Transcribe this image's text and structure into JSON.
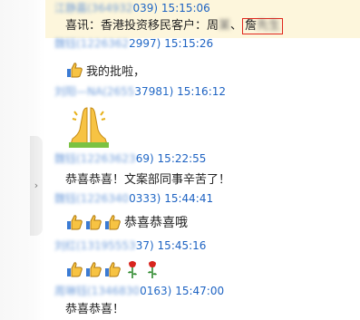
{
  "ui": {
    "collapse_glyph": "›",
    "icons": {
      "thumb": "thumbs-up-emoji",
      "rose": "rose-emoji",
      "praying": "praying-hands-emoji"
    }
  },
  "messages": [
    {
      "sender_blur": "江静嘉(364932",
      "sender_tail": "039)",
      "time": "15:15:06",
      "text_prefix": "喜讯：香港投资移民客户：周",
      "text_blur_1": "某",
      "text_sep": "、",
      "text_boxed_char": "詹",
      "text_blur_2": "先生"
    },
    {
      "sender_blur": "魏钰(1226362",
      "sender_tail": "2997)",
      "time": "15:15:26",
      "text": "我的批啦，"
    },
    {
      "sender_blur": "刘阳—NA(2655",
      "sender_tail": "37981)",
      "time": "15:16:12"
    },
    {
      "sender_blur": "魏钰(12263623",
      "sender_tail": "69)",
      "time": "15:22:55",
      "text": "恭喜恭喜！文案部同事辛苦了！"
    },
    {
      "sender_blur": "魏钰(1226340",
      "sender_tail": "0333)",
      "time": "15:44:41",
      "text": "恭喜恭喜哦"
    },
    {
      "sender_blur": "刘红(13195553",
      "sender_tail": "37)",
      "time": "15:45:16"
    },
    {
      "sender_blur": "周琳钰(1346830",
      "sender_tail": "0163)",
      "time": "15:47:00",
      "text": "恭喜恭喜！"
    }
  ]
}
